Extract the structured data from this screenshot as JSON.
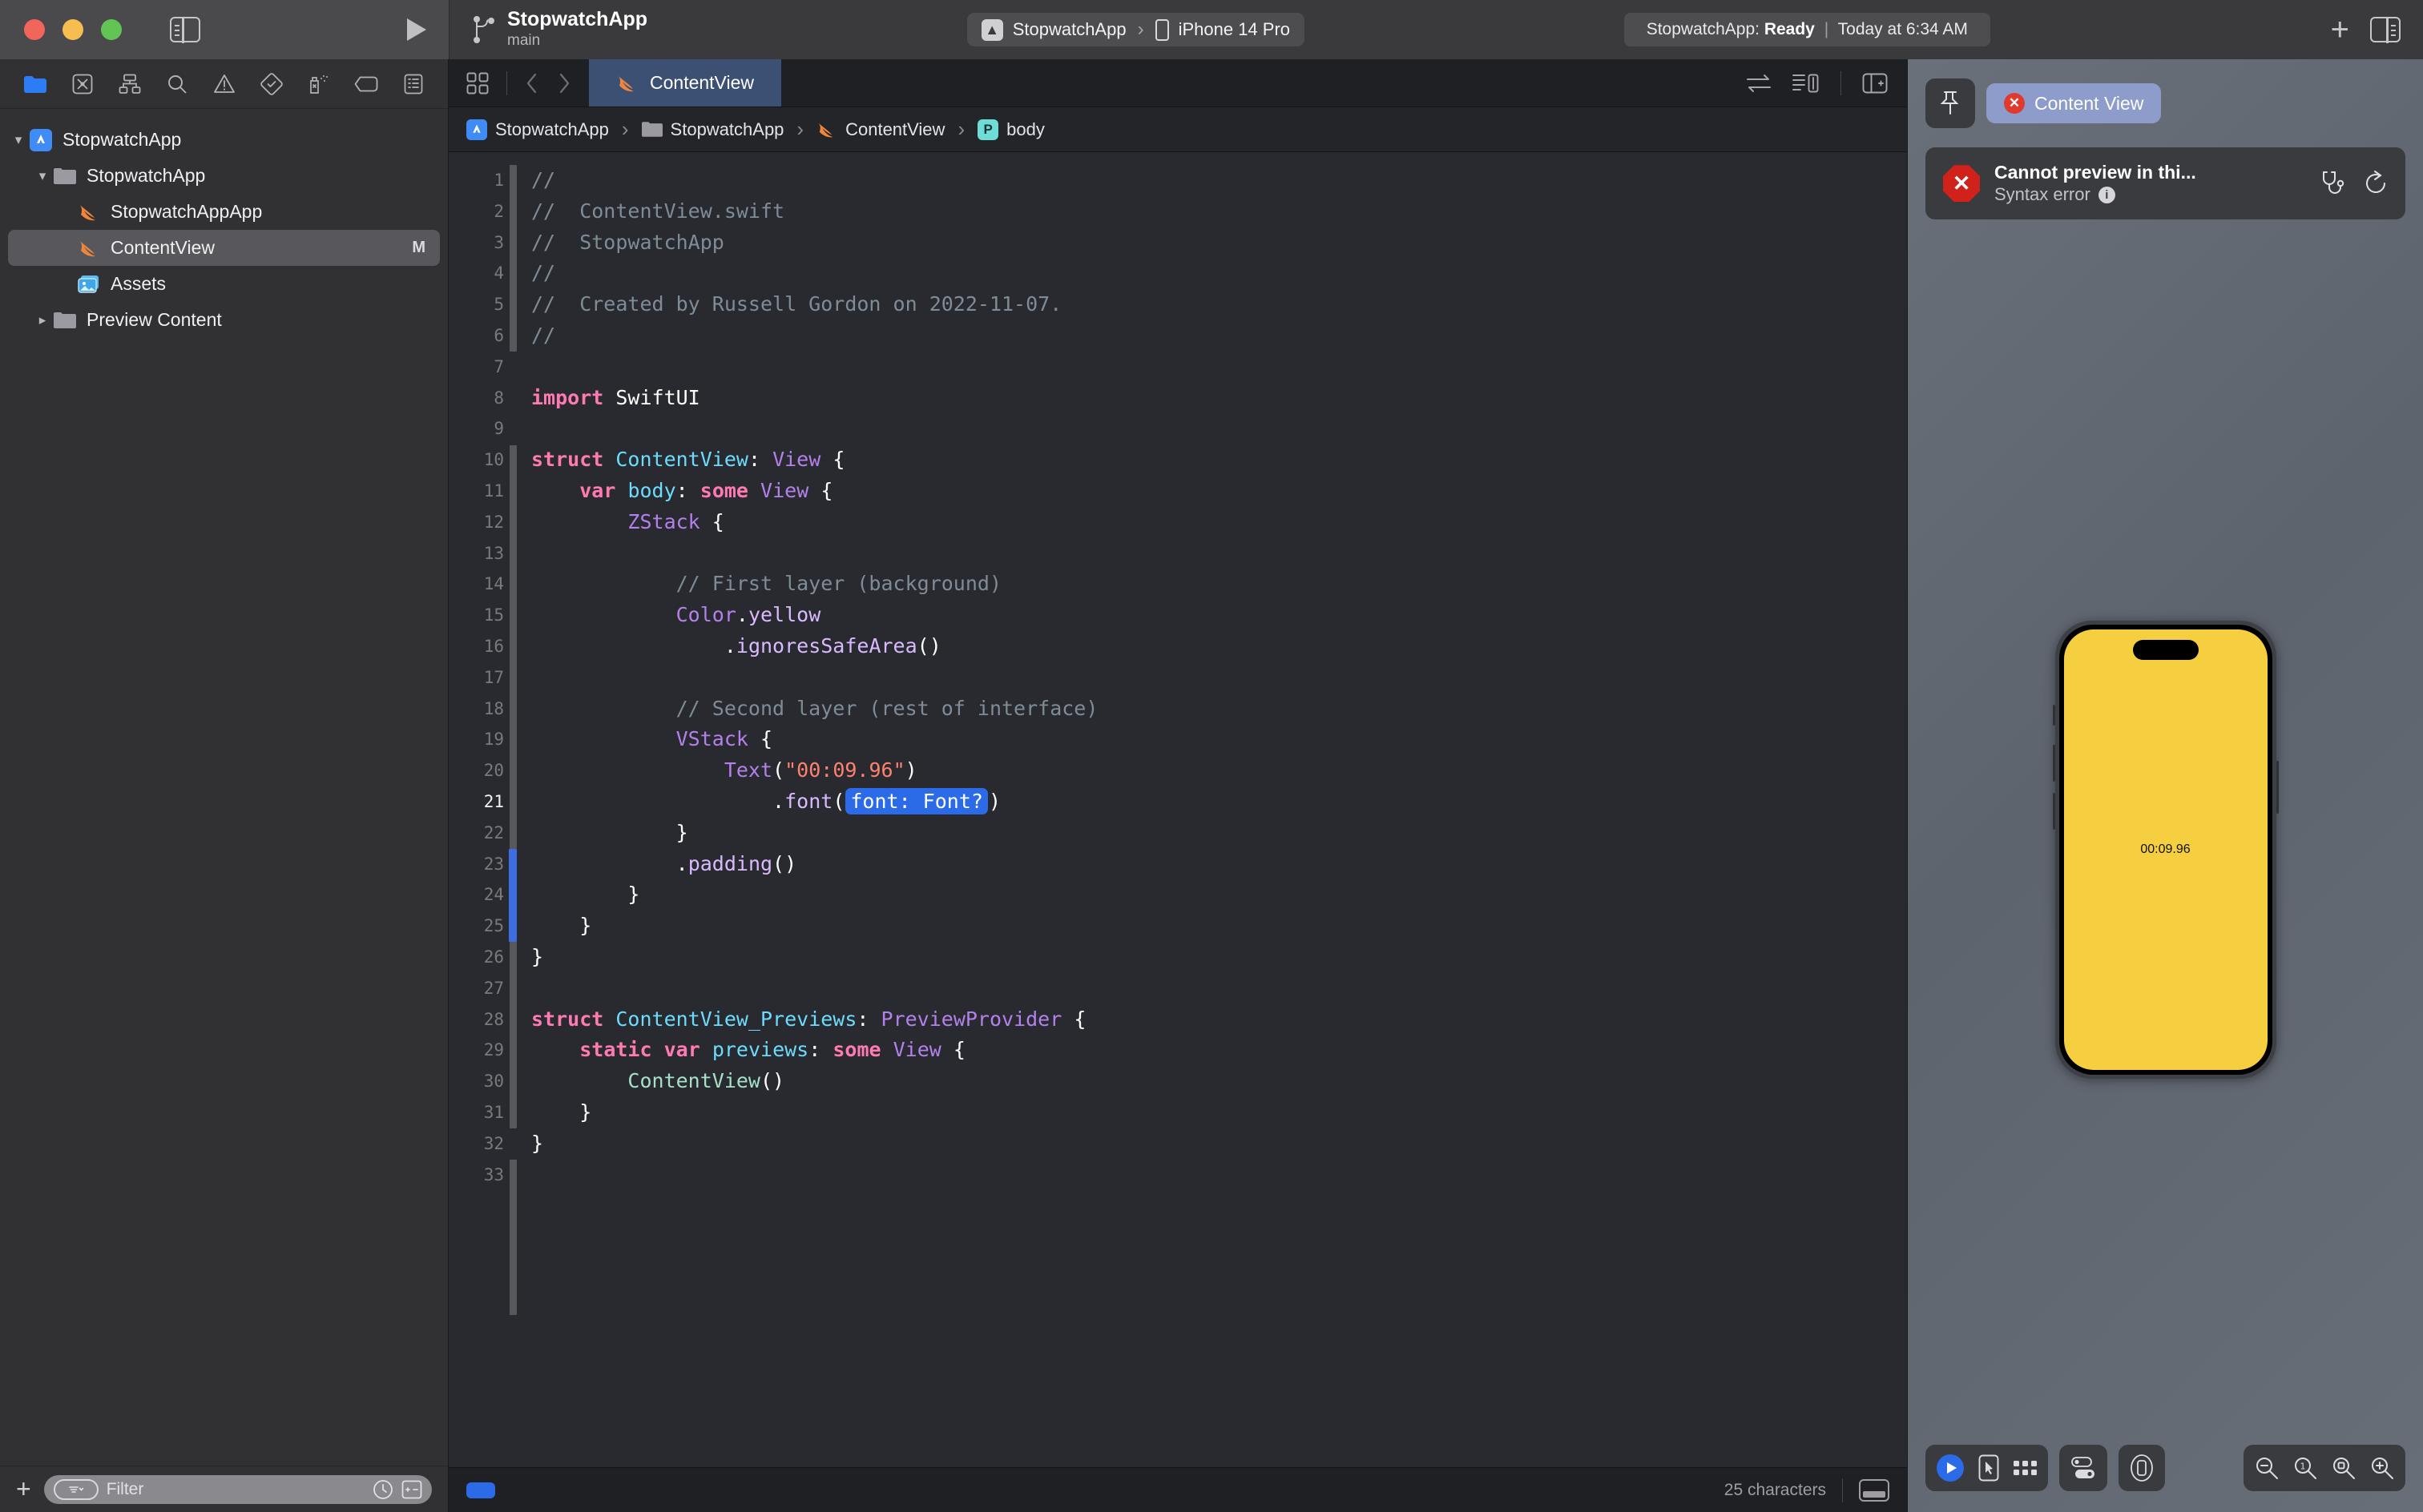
{
  "titlebar": {
    "project_name": "StopwatchApp",
    "branch": "main",
    "scheme": "StopwatchApp",
    "destination": "iPhone 14 Pro",
    "chevron": "›",
    "status_prefix": "StopwatchApp:",
    "status_state": "Ready",
    "status_sep": "|",
    "status_time": "Today at 6:34 AM",
    "add_label": "+"
  },
  "navigator": {
    "tabs": [
      {
        "name": "project-navigator",
        "selected": true
      },
      {
        "name": "source-control-navigator",
        "selected": false
      },
      {
        "name": "hierarchy-navigator",
        "selected": false
      },
      {
        "name": "find-navigator",
        "selected": false
      },
      {
        "name": "issue-navigator",
        "selected": false
      },
      {
        "name": "test-navigator",
        "selected": false
      },
      {
        "name": "debug-navigator",
        "selected": false
      },
      {
        "name": "breakpoint-navigator",
        "selected": false
      },
      {
        "name": "report-navigator",
        "selected": false
      }
    ],
    "items": [
      {
        "label": "StopwatchApp",
        "icon": "app-icon",
        "indent": 0,
        "twisty": "open",
        "badge": "",
        "selected": false
      },
      {
        "label": "StopwatchApp",
        "icon": "folder-icon",
        "indent": 1,
        "twisty": "open",
        "badge": "",
        "selected": false
      },
      {
        "label": "StopwatchAppApp",
        "icon": "swift-icon",
        "indent": 2,
        "twisty": "none",
        "badge": "",
        "selected": false
      },
      {
        "label": "ContentView",
        "icon": "swift-icon",
        "indent": 2,
        "twisty": "none",
        "badge": "M",
        "selected": true
      },
      {
        "label": "Assets",
        "icon": "assets-icon",
        "indent": 2,
        "twisty": "none",
        "badge": "",
        "selected": false
      },
      {
        "label": "Preview Content",
        "icon": "folder-icon",
        "indent": 1,
        "twisty": "closed",
        "badge": "",
        "selected": false
      }
    ],
    "filter_placeholder": "Filter",
    "add_label": "+"
  },
  "editor": {
    "tab_label": "ContentView",
    "breadcrumb": [
      {
        "label": "StopwatchApp",
        "icon": "app-icon"
      },
      {
        "label": "StopwatchApp",
        "icon": "folder-icon"
      },
      {
        "label": "ContentView",
        "icon": "swift-icon"
      },
      {
        "label": "body",
        "icon": "property-badge"
      }
    ],
    "breadcrumb_sep": "›",
    "status_right": "25 characters",
    "lines": [
      {
        "n": 1,
        "tokens": [
          {
            "t": "//",
            "c": "cm"
          }
        ]
      },
      {
        "n": 2,
        "tokens": [
          {
            "t": "//  ContentView.swift",
            "c": "cm"
          }
        ]
      },
      {
        "n": 3,
        "tokens": [
          {
            "t": "//  StopwatchApp",
            "c": "cm"
          }
        ]
      },
      {
        "n": 4,
        "tokens": [
          {
            "t": "//",
            "c": "cm"
          }
        ]
      },
      {
        "n": 5,
        "tokens": [
          {
            "t": "//  Created by Russell Gordon on 2022-11-07.",
            "c": "cm"
          }
        ]
      },
      {
        "n": 6,
        "tokens": [
          {
            "t": "//",
            "c": "cm"
          }
        ]
      },
      {
        "n": 7,
        "tokens": []
      },
      {
        "n": 8,
        "tokens": [
          {
            "t": "import",
            "c": "kw"
          },
          {
            "t": " SwiftUI",
            "c": "pn"
          }
        ]
      },
      {
        "n": 9,
        "tokens": []
      },
      {
        "n": 10,
        "tokens": [
          {
            "t": "struct",
            "c": "kw"
          },
          {
            "t": " ",
            "c": "pn"
          },
          {
            "t": "ContentView",
            "c": "ty"
          },
          {
            "t": ": ",
            "c": "pn"
          },
          {
            "t": "View",
            "c": "ty2"
          },
          {
            "t": " {",
            "c": "pn"
          }
        ]
      },
      {
        "n": 11,
        "tokens": [
          {
            "t": "    ",
            "c": "pn"
          },
          {
            "t": "var",
            "c": "kw"
          },
          {
            "t": " ",
            "c": "pn"
          },
          {
            "t": "body",
            "c": "ty"
          },
          {
            "t": ": ",
            "c": "pn"
          },
          {
            "t": "some",
            "c": "kw"
          },
          {
            "t": " ",
            "c": "pn"
          },
          {
            "t": "View",
            "c": "ty2"
          },
          {
            "t": " {",
            "c": "pn"
          }
        ]
      },
      {
        "n": 12,
        "tokens": [
          {
            "t": "        ",
            "c": "pn"
          },
          {
            "t": "ZStack",
            "c": "ty2"
          },
          {
            "t": " {",
            "c": "pn"
          }
        ]
      },
      {
        "n": 13,
        "tokens": []
      },
      {
        "n": 14,
        "tokens": [
          {
            "t": "            // First layer (background)",
            "c": "cm"
          }
        ]
      },
      {
        "n": 15,
        "tokens": [
          {
            "t": "            ",
            "c": "pn"
          },
          {
            "t": "Color",
            "c": "ty2"
          },
          {
            "t": ".",
            "c": "pn"
          },
          {
            "t": "yellow",
            "c": "pl"
          }
        ]
      },
      {
        "n": 16,
        "tokens": [
          {
            "t": "                ",
            "c": "pn"
          },
          {
            "t": ".",
            "c": "pn"
          },
          {
            "t": "ignoresSafeArea",
            "c": "pl"
          },
          {
            "t": "()",
            "c": "pn"
          }
        ]
      },
      {
        "n": 17,
        "tokens": []
      },
      {
        "n": 18,
        "tokens": [
          {
            "t": "            // Second layer (rest of interface)",
            "c": "cm"
          }
        ]
      },
      {
        "n": 19,
        "tokens": [
          {
            "t": "            ",
            "c": "pn"
          },
          {
            "t": "VStack",
            "c": "ty2"
          },
          {
            "t": " {",
            "c": "pn"
          }
        ]
      },
      {
        "n": 20,
        "tokens": [
          {
            "t": "                ",
            "c": "pn"
          },
          {
            "t": "Text",
            "c": "ty2"
          },
          {
            "t": "(",
            "c": "pn"
          },
          {
            "t": "\"00:09.96\"",
            "c": "st"
          },
          {
            "t": ")",
            "c": "pn"
          }
        ]
      },
      {
        "n": 21,
        "tokens": [
          {
            "t": "                    ",
            "c": "pn"
          },
          {
            "t": ".",
            "c": "pn"
          },
          {
            "t": "font",
            "c": "pl"
          },
          {
            "t": "(",
            "c": "pn"
          },
          {
            "t": "font: Font?",
            "c": "holder"
          },
          {
            "t": ")",
            "c": "pn"
          }
        ],
        "current": true
      },
      {
        "n": 22,
        "tokens": [
          {
            "t": "            }",
            "c": "pn"
          }
        ]
      },
      {
        "n": 23,
        "tokens": [
          {
            "t": "            ",
            "c": "pn"
          },
          {
            "t": ".",
            "c": "pn"
          },
          {
            "t": "padding",
            "c": "pl"
          },
          {
            "t": "()",
            "c": "pn"
          }
        ]
      },
      {
        "n": 24,
        "tokens": [
          {
            "t": "        }",
            "c": "pn"
          }
        ]
      },
      {
        "n": 25,
        "tokens": [
          {
            "t": "    }",
            "c": "pn"
          }
        ]
      },
      {
        "n": 26,
        "tokens": [
          {
            "t": "}",
            "c": "pn"
          }
        ]
      },
      {
        "n": 27,
        "tokens": []
      },
      {
        "n": 28,
        "tokens": [
          {
            "t": "struct",
            "c": "kw"
          },
          {
            "t": " ",
            "c": "pn"
          },
          {
            "t": "ContentView_Previews",
            "c": "ty"
          },
          {
            "t": ": ",
            "c": "pn"
          },
          {
            "t": "PreviewProvider",
            "c": "ty2"
          },
          {
            "t": " {",
            "c": "pn"
          }
        ]
      },
      {
        "n": 29,
        "tokens": [
          {
            "t": "    ",
            "c": "pn"
          },
          {
            "t": "static",
            "c": "kw"
          },
          {
            "t": " ",
            "c": "pn"
          },
          {
            "t": "var",
            "c": "kw"
          },
          {
            "t": " ",
            "c": "pn"
          },
          {
            "t": "previews",
            "c": "ty"
          },
          {
            "t": ": ",
            "c": "pn"
          },
          {
            "t": "some",
            "c": "kw"
          },
          {
            "t": " ",
            "c": "pn"
          },
          {
            "t": "View",
            "c": "ty2"
          },
          {
            "t": " {",
            "c": "pn"
          }
        ]
      },
      {
        "n": 30,
        "tokens": [
          {
            "t": "        ",
            "c": "pn"
          },
          {
            "t": "ContentView",
            "c": "fn"
          },
          {
            "t": "()",
            "c": "pn"
          }
        ]
      },
      {
        "n": 31,
        "tokens": [
          {
            "t": "    }",
            "c": "pn"
          }
        ]
      },
      {
        "n": 32,
        "tokens": [
          {
            "t": "}",
            "c": "pn"
          }
        ]
      },
      {
        "n": 33,
        "tokens": []
      }
    ]
  },
  "canvas": {
    "preview_chip_label": "Content View",
    "error_title": "Cannot preview in thi...",
    "error_subtitle": "Syntax error",
    "error_icon": "error-octagon",
    "diagnostics_icon": "stethoscope-icon",
    "refresh_icon": "refresh-icon",
    "device_screen_text": "00:09.96",
    "screen_color": "#f5cf40",
    "zoom_controls": [
      "zoom-out",
      "zoom-100",
      "zoom-fit",
      "zoom-in"
    ]
  }
}
